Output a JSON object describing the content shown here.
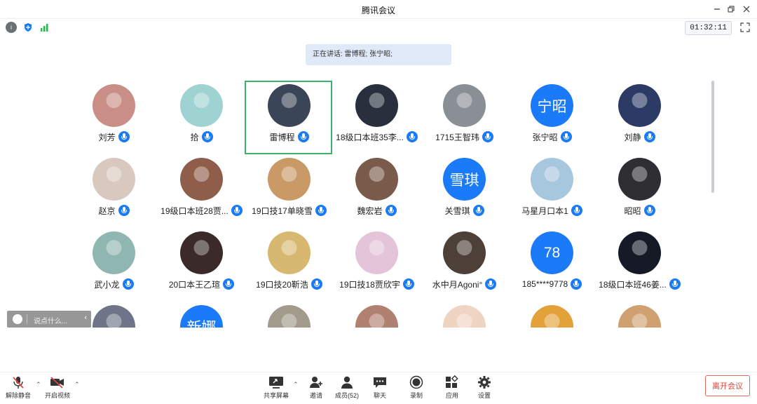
{
  "window": {
    "title": "腾讯会议"
  },
  "timer": "01:32:11",
  "speaking": "正在讲话: 雷博程; 张宁昭;",
  "chat": {
    "placeholder": "说点什么..."
  },
  "participants": [
    {
      "name": "刘芳",
      "avatar_color": "#c98e86"
    },
    {
      "name": "拾",
      "avatar_color": "#9fd3d2"
    },
    {
      "name": "雷博程",
      "avatar_color": "#3b4558",
      "active": true
    },
    {
      "name": "18级口本班35李...",
      "avatar_color": "#28303d"
    },
    {
      "name": "1715王智玮",
      "avatar_color": "#8a8e95"
    },
    {
      "name": "张宁昭",
      "avatar_text": "宁昭"
    },
    {
      "name": "刘静",
      "avatar_color": "#2c3a66"
    },
    {
      "name": "赵京",
      "avatar_color": "#d8c8be"
    },
    {
      "name": "19级口本班28贾...",
      "avatar_color": "#8f5e4a"
    },
    {
      "name": "19口技17单晓雪",
      "avatar_color": "#c99a66"
    },
    {
      "name": "魏宏岩",
      "avatar_color": "#7a5a4a"
    },
    {
      "name": "关雪琪",
      "avatar_text": "雪琪"
    },
    {
      "name": "马星月口本1",
      "avatar_color": "#a7c7df"
    },
    {
      "name": "昭昭",
      "avatar_color": "#2f2f33"
    },
    {
      "name": "武小龙",
      "avatar_color": "#8fb6b0"
    },
    {
      "name": "20口本王乙瑄",
      "avatar_color": "#3a2a2a"
    },
    {
      "name": "19口技20靳浩",
      "avatar_color": "#d7b870"
    },
    {
      "name": "19口技18贾欣宇",
      "avatar_color": "#e4c4d8"
    },
    {
      "name": "水中月Agoni°",
      "avatar_color": "#4c4038"
    },
    {
      "name": "185****9778",
      "avatar_text": "78"
    },
    {
      "name": "18级口本班46姜...",
      "avatar_color": "#161a26"
    },
    {
      "name": "",
      "avatar_color": "#6e7588"
    },
    {
      "name": "",
      "avatar_text": "新娜"
    },
    {
      "name": "",
      "avatar_color": "#a29a8a"
    },
    {
      "name": "",
      "avatar_color": "#b08070"
    },
    {
      "name": "",
      "avatar_color": "#f0d4c2"
    },
    {
      "name": "",
      "avatar_color": "#e3a13a"
    },
    {
      "name": "",
      "avatar_color": "#cfa070"
    }
  ],
  "toolbar": {
    "unmute": "解除静音",
    "video": "开启视频",
    "share": "共享屏幕",
    "invite": "邀请",
    "members": "成员(52)",
    "chat": "聊天",
    "record": "录制",
    "apps": "应用",
    "settings": "设置",
    "leave": "离开会议"
  },
  "colors": {
    "accent": "#1a7af8",
    "active_border": "#3cb36b",
    "leave": "#e0443a"
  }
}
